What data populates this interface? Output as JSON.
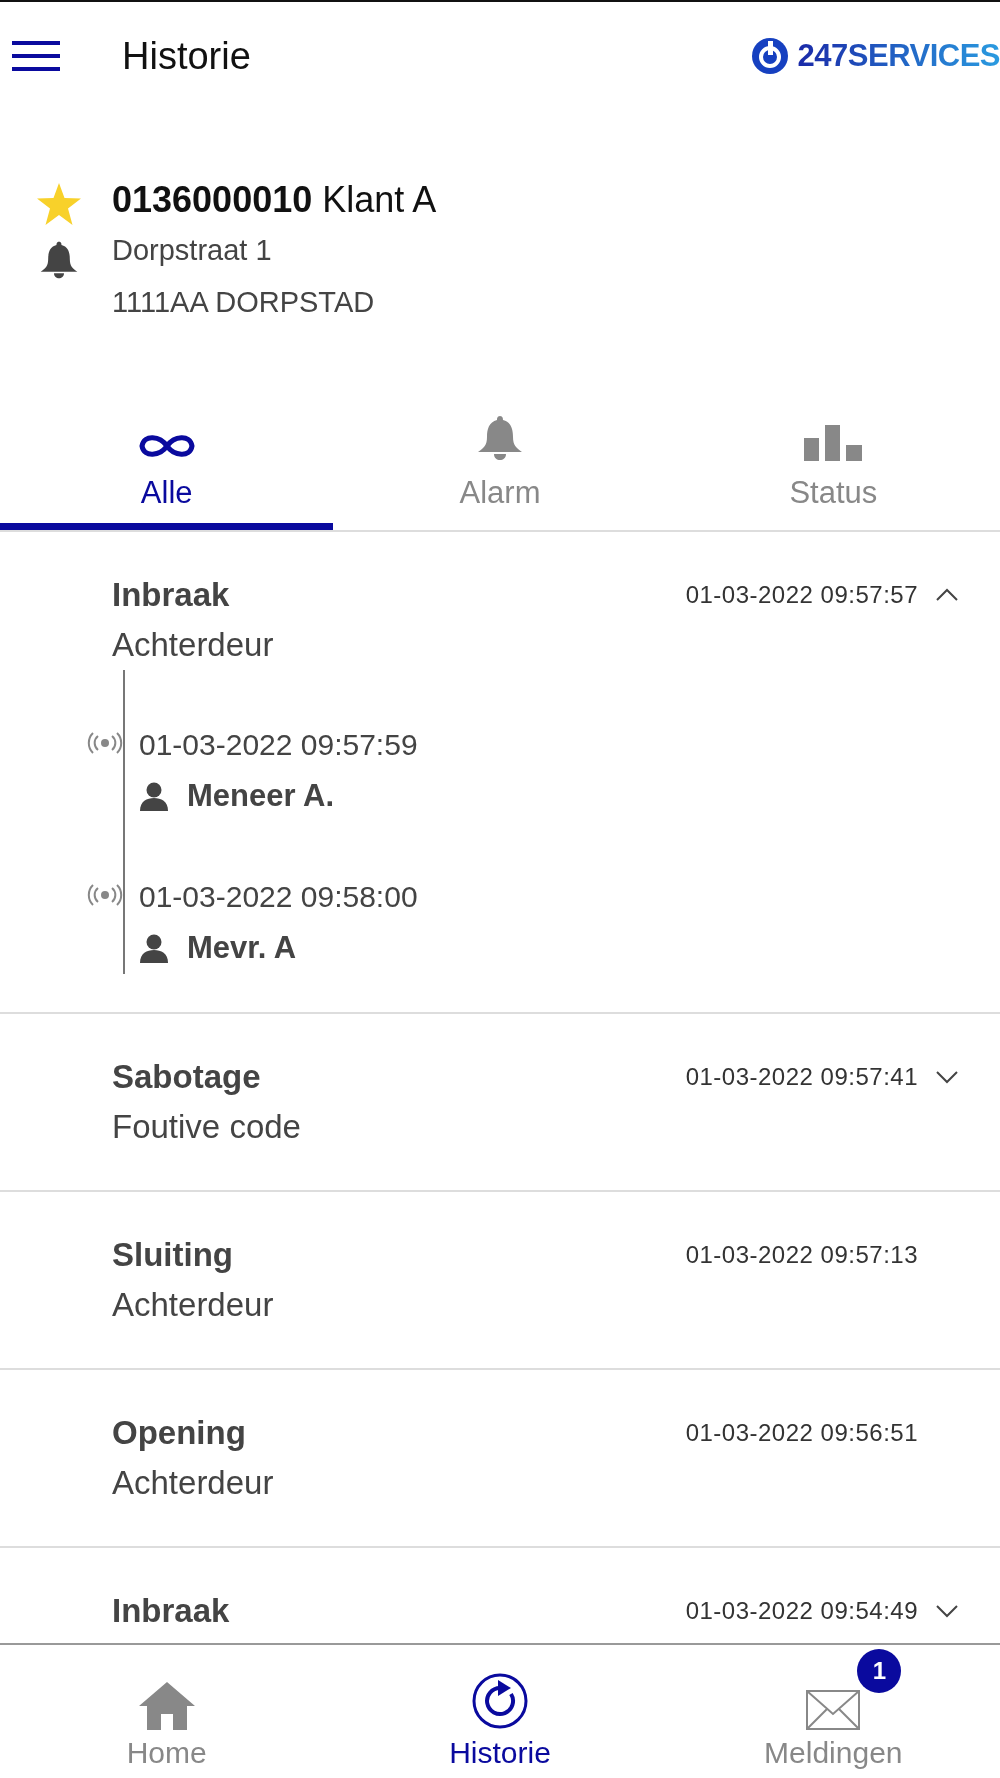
{
  "header": {
    "title": "Historie",
    "logo_text": "247SERVICES"
  },
  "customer": {
    "number": "0136000010",
    "name": "Klant A",
    "address": "Dorpstraat 1",
    "city": "1111AA DORPSTAD",
    "favorite": true
  },
  "tabs": [
    {
      "label": "Alle",
      "kind": "all",
      "selected": true
    },
    {
      "label": "Alarm",
      "kind": "alarm",
      "selected": false
    },
    {
      "label": "Status",
      "kind": "status",
      "selected": false
    }
  ],
  "events": [
    {
      "title": "Inbraak",
      "subtitle": "Achterdeur",
      "time": "01-03-2022 09:57:57",
      "kind": "expandable",
      "expanded": true,
      "children": [
        {
          "time": "01-03-2022 09:57:59",
          "person": "Meneer A."
        },
        {
          "time": "01-03-2022 09:58:00",
          "person": "Mevr. A"
        }
      ]
    },
    {
      "title": "Sabotage",
      "subtitle": "Foutive code",
      "time": "01-03-2022 09:57:41",
      "kind": "expandable",
      "expanded": false
    },
    {
      "title": "Sluiting",
      "subtitle": "Achterdeur",
      "time": "01-03-2022 09:57:13",
      "kind": "plain"
    },
    {
      "title": "Opening",
      "subtitle": "Achterdeur",
      "time": "01-03-2022 09:56:51",
      "kind": "plain"
    },
    {
      "title": "Inbraak",
      "time": "01-03-2022 09:54:49",
      "kind": "expandable",
      "expanded": false
    }
  ],
  "bottom_nav": [
    {
      "label": "Home",
      "kind": "home",
      "selected": false
    },
    {
      "label": "Historie",
      "kind": "history",
      "selected": true
    },
    {
      "label": "Meldingen",
      "kind": "messages",
      "selected": false,
      "badge": "1"
    }
  ]
}
